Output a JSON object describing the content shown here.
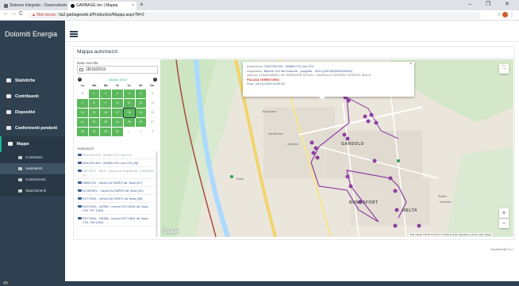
{
  "browser": {
    "tabs": [
      {
        "title": "Sistema Integrato - Osservatorio"
      },
      {
        "title": "GARBAGE ten | Mappa"
      }
    ],
    "new_tab": "+",
    "window_controls": "– ❐ ✕",
    "url_warning": "Non sicuro",
    "url": "ita2.garbageweb.it/Production/Mappa.aspx?M=2",
    "nav": {
      "back": "←",
      "forward": "→",
      "reload": "C"
    }
  },
  "sidebar": {
    "brand": "Dolomiti Energia",
    "items": [
      {
        "label": "Statistiche",
        "icon": "chart-icon"
      },
      {
        "label": "Contribuenti",
        "icon": "users-icon"
      },
      {
        "label": "Dispositivi",
        "icon": "device-icon"
      },
      {
        "label": "Conferimenti pendenti",
        "icon": "warning-icon"
      },
      {
        "label": "Mappe",
        "icon": "map-marker-icon"
      }
    ],
    "subitems": [
      {
        "label": "Contenitori"
      },
      {
        "label": "Automezzi"
      },
      {
        "label": "Conferimenti"
      },
      {
        "label": "Spazzamenti"
      }
    ]
  },
  "panel": {
    "title": "Mappa automezzi",
    "date_label": "Data raccolta",
    "date_value": "18/10/2019",
    "list_label": "Automezzi"
  },
  "calendar": {
    "month": "Ottobre 2019",
    "prev": "‹",
    "next": "›",
    "weekdays": [
      "Lu",
      "Ma",
      "Me",
      "Gi",
      "Ve",
      "Sa",
      "Do"
    ],
    "rows": [
      [
        "30",
        "1",
        "2",
        "3",
        "4",
        "5",
        "6"
      ],
      [
        "7",
        "8",
        "9",
        "10",
        "11",
        "12",
        "13"
      ],
      [
        "14",
        "15",
        "16",
        "17",
        "18",
        "19",
        "20"
      ],
      [
        "21",
        "22",
        "23",
        "24",
        "25",
        "26",
        "27"
      ],
      [
        "28",
        "29",
        "30",
        "31",
        "1",
        "2",
        "3"
      ]
    ]
  },
  "vehicles": [
    "005-032-033 - MOBA CS1 con 070",
    "005-033-320 - MOBA CS1 con 070 (35)",
    "DB764TY - MUS - Mezzo di Gravelli alt. CANDRAI (1)",
    "DB647JD - mezzo ALTARES alt. fissa (47)",
    "DC520WV - mezzo ALTARES alt. fissa (32)",
    "ED713ML - mezzo ALTARES alt. fissa (65)",
    "ED712ML - MOBA - mezzo ED712ML alt. fissa CS1 767 (150)",
    "ED713ML - MOBA - mezzo ED713ML alt. fissa CS1 766 (150)"
  ],
  "infowindow": {
    "row1_key": "Automezzo:",
    "row1_val": "005-033-033 - MOBA CS1 con 070",
    "row2_key": "Dispositivo:",
    "row2_val": "Bidone 120 litri marrone - progetto - 5314 (S9C500000000000)",
    "row3_key": "Utenza:",
    "row3_val": "CONDOMINIO LE TERRAZZE SCIVIS - GARDOLO CENTRO VENDITE MOLA",
    "row4": "PULIZIA TERRITORIO",
    "row5_key": "Data:",
    "row5_val": "18-10-2019 10:02:32",
    "close": "×"
  },
  "map": {
    "places": [
      "GARDOLO",
      "Gardolo",
      "RONCAFORT",
      "MELTA",
      "Bolleri",
      "Vecchia",
      "Thuis"
    ],
    "roads": [
      "Via Bolzano",
      "Via Bolzano"
    ],
    "google": "Google",
    "footer": "Dati mappa ©2019   Termini e condizioni d'uso   Segnala un errore nella mappa",
    "fullscreen": "⛶",
    "zoom_in": "+",
    "zoom_out": "−",
    "colors": {
      "marker": "#8e3fa3",
      "route": "#8e3fa3",
      "river": "#aadaff",
      "rail": "#a84b3f",
      "highway": "#f3d36a"
    }
  },
  "footer_text": "HardwKnife S.r.l."
}
